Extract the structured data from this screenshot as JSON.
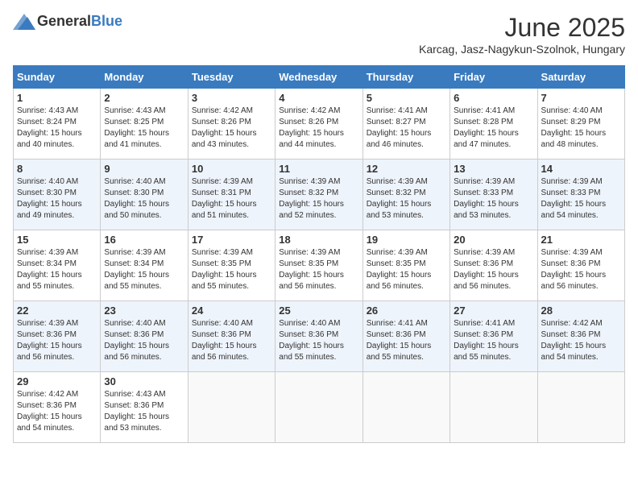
{
  "header": {
    "logo_general": "General",
    "logo_blue": "Blue",
    "month_title": "June 2025",
    "location": "Karcag, Jasz-Nagykun-Szolnok, Hungary"
  },
  "weekdays": [
    "Sunday",
    "Monday",
    "Tuesday",
    "Wednesday",
    "Thursday",
    "Friday",
    "Saturday"
  ],
  "weeks": [
    [
      {
        "day": "1",
        "sunrise": "Sunrise: 4:43 AM",
        "sunset": "Sunset: 8:24 PM",
        "daylight": "Daylight: 15 hours and 40 minutes."
      },
      {
        "day": "2",
        "sunrise": "Sunrise: 4:43 AM",
        "sunset": "Sunset: 8:25 PM",
        "daylight": "Daylight: 15 hours and 41 minutes."
      },
      {
        "day": "3",
        "sunrise": "Sunrise: 4:42 AM",
        "sunset": "Sunset: 8:26 PM",
        "daylight": "Daylight: 15 hours and 43 minutes."
      },
      {
        "day": "4",
        "sunrise": "Sunrise: 4:42 AM",
        "sunset": "Sunset: 8:26 PM",
        "daylight": "Daylight: 15 hours and 44 minutes."
      },
      {
        "day": "5",
        "sunrise": "Sunrise: 4:41 AM",
        "sunset": "Sunset: 8:27 PM",
        "daylight": "Daylight: 15 hours and 46 minutes."
      },
      {
        "day": "6",
        "sunrise": "Sunrise: 4:41 AM",
        "sunset": "Sunset: 8:28 PM",
        "daylight": "Daylight: 15 hours and 47 minutes."
      },
      {
        "day": "7",
        "sunrise": "Sunrise: 4:40 AM",
        "sunset": "Sunset: 8:29 PM",
        "daylight": "Daylight: 15 hours and 48 minutes."
      }
    ],
    [
      {
        "day": "8",
        "sunrise": "Sunrise: 4:40 AM",
        "sunset": "Sunset: 8:30 PM",
        "daylight": "Daylight: 15 hours and 49 minutes."
      },
      {
        "day": "9",
        "sunrise": "Sunrise: 4:40 AM",
        "sunset": "Sunset: 8:30 PM",
        "daylight": "Daylight: 15 hours and 50 minutes."
      },
      {
        "day": "10",
        "sunrise": "Sunrise: 4:39 AM",
        "sunset": "Sunset: 8:31 PM",
        "daylight": "Daylight: 15 hours and 51 minutes."
      },
      {
        "day": "11",
        "sunrise": "Sunrise: 4:39 AM",
        "sunset": "Sunset: 8:32 PM",
        "daylight": "Daylight: 15 hours and 52 minutes."
      },
      {
        "day": "12",
        "sunrise": "Sunrise: 4:39 AM",
        "sunset": "Sunset: 8:32 PM",
        "daylight": "Daylight: 15 hours and 53 minutes."
      },
      {
        "day": "13",
        "sunrise": "Sunrise: 4:39 AM",
        "sunset": "Sunset: 8:33 PM",
        "daylight": "Daylight: 15 hours and 53 minutes."
      },
      {
        "day": "14",
        "sunrise": "Sunrise: 4:39 AM",
        "sunset": "Sunset: 8:33 PM",
        "daylight": "Daylight: 15 hours and 54 minutes."
      }
    ],
    [
      {
        "day": "15",
        "sunrise": "Sunrise: 4:39 AM",
        "sunset": "Sunset: 8:34 PM",
        "daylight": "Daylight: 15 hours and 55 minutes."
      },
      {
        "day": "16",
        "sunrise": "Sunrise: 4:39 AM",
        "sunset": "Sunset: 8:34 PM",
        "daylight": "Daylight: 15 hours and 55 minutes."
      },
      {
        "day": "17",
        "sunrise": "Sunrise: 4:39 AM",
        "sunset": "Sunset: 8:35 PM",
        "daylight": "Daylight: 15 hours and 55 minutes."
      },
      {
        "day": "18",
        "sunrise": "Sunrise: 4:39 AM",
        "sunset": "Sunset: 8:35 PM",
        "daylight": "Daylight: 15 hours and 56 minutes."
      },
      {
        "day": "19",
        "sunrise": "Sunrise: 4:39 AM",
        "sunset": "Sunset: 8:35 PM",
        "daylight": "Daylight: 15 hours and 56 minutes."
      },
      {
        "day": "20",
        "sunrise": "Sunrise: 4:39 AM",
        "sunset": "Sunset: 8:36 PM",
        "daylight": "Daylight: 15 hours and 56 minutes."
      },
      {
        "day": "21",
        "sunrise": "Sunrise: 4:39 AM",
        "sunset": "Sunset: 8:36 PM",
        "daylight": "Daylight: 15 hours and 56 minutes."
      }
    ],
    [
      {
        "day": "22",
        "sunrise": "Sunrise: 4:39 AM",
        "sunset": "Sunset: 8:36 PM",
        "daylight": "Daylight: 15 hours and 56 minutes."
      },
      {
        "day": "23",
        "sunrise": "Sunrise: 4:40 AM",
        "sunset": "Sunset: 8:36 PM",
        "daylight": "Daylight: 15 hours and 56 minutes."
      },
      {
        "day": "24",
        "sunrise": "Sunrise: 4:40 AM",
        "sunset": "Sunset: 8:36 PM",
        "daylight": "Daylight: 15 hours and 56 minutes."
      },
      {
        "day": "25",
        "sunrise": "Sunrise: 4:40 AM",
        "sunset": "Sunset: 8:36 PM",
        "daylight": "Daylight: 15 hours and 55 minutes."
      },
      {
        "day": "26",
        "sunrise": "Sunrise: 4:41 AM",
        "sunset": "Sunset: 8:36 PM",
        "daylight": "Daylight: 15 hours and 55 minutes."
      },
      {
        "day": "27",
        "sunrise": "Sunrise: 4:41 AM",
        "sunset": "Sunset: 8:36 PM",
        "daylight": "Daylight: 15 hours and 55 minutes."
      },
      {
        "day": "28",
        "sunrise": "Sunrise: 4:42 AM",
        "sunset": "Sunset: 8:36 PM",
        "daylight": "Daylight: 15 hours and 54 minutes."
      }
    ],
    [
      {
        "day": "29",
        "sunrise": "Sunrise: 4:42 AM",
        "sunset": "Sunset: 8:36 PM",
        "daylight": "Daylight: 15 hours and 54 minutes."
      },
      {
        "day": "30",
        "sunrise": "Sunrise: 4:43 AM",
        "sunset": "Sunset: 8:36 PM",
        "daylight": "Daylight: 15 hours and 53 minutes."
      },
      null,
      null,
      null,
      null,
      null
    ]
  ]
}
